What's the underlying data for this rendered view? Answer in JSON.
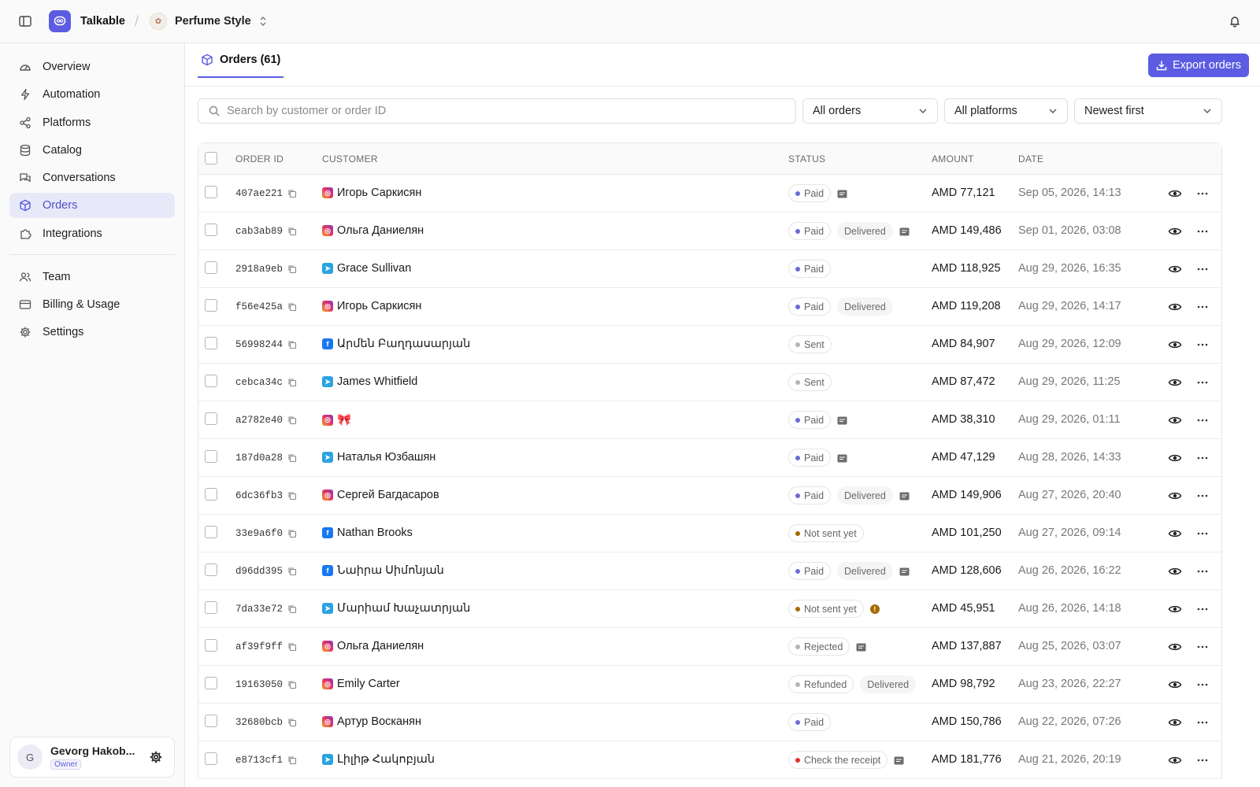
{
  "app": {
    "name": "Talkable",
    "logo_icon": "chat-link-icon"
  },
  "store": {
    "name": "Perfume Style"
  },
  "sidebar": {
    "items": [
      {
        "label": "Overview",
        "icon": "gauge-icon"
      },
      {
        "label": "Automation",
        "icon": "lightning-icon"
      },
      {
        "label": "Platforms",
        "icon": "share-icon"
      },
      {
        "label": "Catalog",
        "icon": "database-icon"
      },
      {
        "label": "Conversations",
        "icon": "chat-bubbles-icon"
      },
      {
        "label": "Orders",
        "icon": "box-icon",
        "active": true
      },
      {
        "label": "Integrations",
        "icon": "puzzle-icon"
      },
      {
        "label": "Team",
        "icon": "users-icon"
      },
      {
        "label": "Billing & Usage",
        "icon": "credit-card-icon"
      },
      {
        "label": "Settings",
        "icon": "gear-icon"
      }
    ],
    "user": {
      "initial": "G",
      "name": "Gevorg Hakob...",
      "role": "Owner"
    }
  },
  "main": {
    "tab_label": "Orders (61)",
    "export_label": "Export orders",
    "search_placeholder": "Search by customer or order ID",
    "filters": {
      "status": "All orders",
      "platform": "All platforms",
      "sort": "Newest first"
    },
    "columns": [
      "ORDER ID",
      "CUSTOMER",
      "STATUS",
      "AMOUNT",
      "DATE"
    ]
  },
  "colors": {
    "accent": "#5b5ce2",
    "paid_dot": "#6b6bd6",
    "sent_dot": "#b5b5b5",
    "not_sent_dot": "#a56a00",
    "rejected_dot": "#b5b5b5",
    "refunded_dot": "#b5b5b5",
    "check_dot": "#e03131"
  },
  "orders": [
    {
      "id": "407ae221",
      "platform": "instagram",
      "customer": "Игорь Саркисян",
      "status": "Paid",
      "dot": "paid",
      "sub": "",
      "note": true,
      "alert": false,
      "amount": "AMD 77,121",
      "date": "Sep 05, 2026, 14:13"
    },
    {
      "id": "cab3ab89",
      "platform": "instagram",
      "customer": "Ольга Даниелян",
      "status": "Paid",
      "dot": "paid",
      "sub": "Delivered",
      "note": true,
      "alert": false,
      "amount": "AMD 149,486",
      "date": "Sep 01, 2026, 03:08"
    },
    {
      "id": "2918a9eb",
      "platform": "telegram",
      "customer": "Grace Sullivan",
      "status": "Paid",
      "dot": "paid",
      "sub": "",
      "note": false,
      "alert": false,
      "amount": "AMD 118,925",
      "date": "Aug 29, 2026, 16:35"
    },
    {
      "id": "f56e425a",
      "platform": "instagram",
      "customer": "Игорь Саркисян",
      "status": "Paid",
      "dot": "paid",
      "sub": "Delivered",
      "note": false,
      "alert": false,
      "amount": "AMD 119,208",
      "date": "Aug 29, 2026, 14:17"
    },
    {
      "id": "56998244",
      "platform": "facebook",
      "customer": "Արմեն Բաղդասարյան",
      "status": "Sent",
      "dot": "sent",
      "sub": "",
      "note": false,
      "alert": false,
      "amount": "AMD 84,907",
      "date": "Aug 29, 2026, 12:09"
    },
    {
      "id": "cebca34c",
      "platform": "telegram",
      "customer": "James Whitfield",
      "status": "Sent",
      "dot": "sent",
      "sub": "",
      "note": false,
      "alert": false,
      "amount": "AMD 87,472",
      "date": "Aug 29, 2026, 11:25"
    },
    {
      "id": "a2782e40",
      "platform": "instagram",
      "customer": "🎀",
      "status": "Paid",
      "dot": "paid",
      "sub": "",
      "note": true,
      "alert": false,
      "amount": "AMD 38,310",
      "date": "Aug 29, 2026, 01:11"
    },
    {
      "id": "187d0a28",
      "platform": "telegram",
      "customer": "Наталья Юзбашян",
      "status": "Paid",
      "dot": "paid",
      "sub": "",
      "note": true,
      "alert": false,
      "amount": "AMD 47,129",
      "date": "Aug 28, 2026, 14:33"
    },
    {
      "id": "6dc36fb3",
      "platform": "instagram",
      "customer": "Сергей Багдасаров",
      "status": "Paid",
      "dot": "paid",
      "sub": "Delivered",
      "note": true,
      "alert": false,
      "amount": "AMD 149,906",
      "date": "Aug 27, 2026, 20:40"
    },
    {
      "id": "33e9a6f0",
      "platform": "facebook",
      "customer": "Nathan Brooks",
      "status": "Not sent yet",
      "dot": "not_sent",
      "sub": "",
      "note": false,
      "alert": false,
      "amount": "AMD 101,250",
      "date": "Aug 27, 2026, 09:14"
    },
    {
      "id": "d96dd395",
      "platform": "facebook",
      "customer": "Նաիրա Սիմոնյան",
      "status": "Paid",
      "dot": "paid",
      "sub": "Delivered",
      "note": true,
      "alert": false,
      "amount": "AMD 128,606",
      "date": "Aug 26, 2026, 16:22"
    },
    {
      "id": "7da33e72",
      "platform": "telegram",
      "customer": "Մարիամ Խաչատրյան",
      "status": "Not sent yet",
      "dot": "not_sent",
      "sub": "",
      "note": false,
      "alert": true,
      "amount": "AMD 45,951",
      "date": "Aug 26, 2026, 14:18"
    },
    {
      "id": "af39f9ff",
      "platform": "instagram",
      "customer": "Ольга Даниелян",
      "status": "Rejected",
      "dot": "rejected",
      "sub": "",
      "note": true,
      "alert": false,
      "amount": "AMD 137,887",
      "date": "Aug 25, 2026, 03:07"
    },
    {
      "id": "19163050",
      "platform": "instagram",
      "customer": "Emily Carter",
      "status": "Refunded",
      "dot": "refunded",
      "sub": "Delivered",
      "note": false,
      "alert": false,
      "amount": "AMD 98,792",
      "date": "Aug 23, 2026, 22:27"
    },
    {
      "id": "32680bcb",
      "platform": "instagram",
      "customer": "Артур Восканян",
      "status": "Paid",
      "dot": "paid",
      "sub": "",
      "note": false,
      "alert": false,
      "amount": "AMD 150,786",
      "date": "Aug 22, 2026, 07:26"
    },
    {
      "id": "e8713cf1",
      "platform": "telegram",
      "customer": "Լիլիթ Հակոբյան",
      "status": "Check the receipt",
      "dot": "check",
      "sub": "",
      "note": true,
      "alert": false,
      "amount": "AMD 181,776",
      "date": "Aug 21, 2026, 20:19"
    }
  ]
}
